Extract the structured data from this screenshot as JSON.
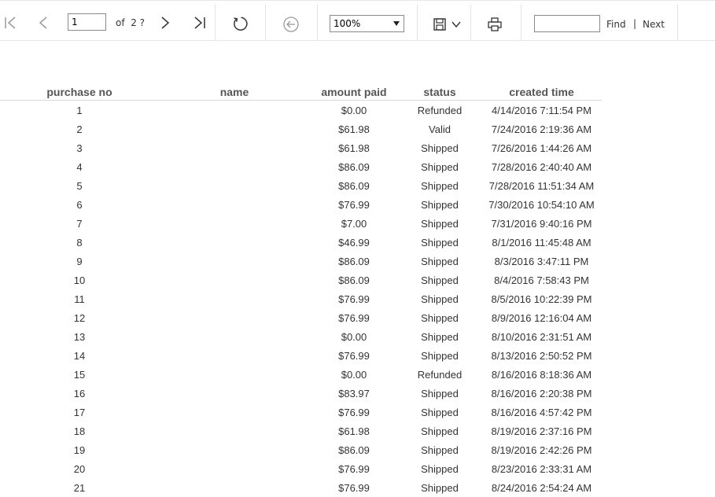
{
  "toolbar": {
    "page_current": "1",
    "page_of_label": "of  2 ?",
    "zoom_value": "100%",
    "find_value": "",
    "find_label": "Find",
    "separator": "|",
    "next_label": "Next",
    "icons": {
      "first_page": "first-page-icon",
      "previous_page": "previous-page-icon",
      "next_page": "next-page-icon",
      "last_page": "last-page-icon",
      "refresh": "refresh-icon",
      "back": "back-icon",
      "save": "save-icon",
      "print": "print-icon"
    }
  },
  "report": {
    "columns": [
      "purchase no",
      "name",
      "amount paid",
      "status",
      "created time"
    ],
    "rows": [
      [
        "1",
        "",
        "$0.00",
        "Refunded",
        "4/14/2016 7:11:54 PM"
      ],
      [
        "2",
        "",
        "$61.98",
        "Valid",
        "7/24/2016 2:19:36 AM"
      ],
      [
        "3",
        "",
        "$61.98",
        "Shipped",
        "7/26/2016 1:44:26 AM"
      ],
      [
        "4",
        "",
        "$86.09",
        "Shipped",
        "7/28/2016 2:40:40 AM"
      ],
      [
        "5",
        "",
        "$86.09",
        "Shipped",
        "7/28/2016 11:51:34 AM"
      ],
      [
        "6",
        "",
        "$76.99",
        "Shipped",
        "7/30/2016 10:54:10 AM"
      ],
      [
        "7",
        "",
        "$7.00",
        "Shipped",
        "7/31/2016 9:40:16 PM"
      ],
      [
        "8",
        "",
        "$46.99",
        "Shipped",
        "8/1/2016 11:45:48 AM"
      ],
      [
        "9",
        "",
        "$86.09",
        "Shipped",
        "8/3/2016 3:47:11 PM"
      ],
      [
        "10",
        "",
        "$86.09",
        "Shipped",
        "8/4/2016 7:58:43 PM"
      ],
      [
        "11",
        "",
        "$76.99",
        "Shipped",
        "8/5/2016 10:22:39 PM"
      ],
      [
        "12",
        "",
        "$76.99",
        "Shipped",
        "8/9/2016 12:16:04 AM"
      ],
      [
        "13",
        "",
        "$0.00",
        "Shipped",
        "8/10/2016 2:31:51 AM"
      ],
      [
        "14",
        "",
        "$76.99",
        "Shipped",
        "8/13/2016 2:50:52 PM"
      ],
      [
        "15",
        "",
        "$0.00",
        "Refunded",
        "8/16/2016 8:18:36 AM"
      ],
      [
        "16",
        "",
        "$83.97",
        "Shipped",
        "8/16/2016 2:20:38 PM"
      ],
      [
        "17",
        "",
        "$76.99",
        "Shipped",
        "8/16/2016 4:57:42 PM"
      ],
      [
        "18",
        "",
        "$61.98",
        "Shipped",
        "8/19/2016 2:37:16 PM"
      ],
      [
        "19",
        "",
        "$86.09",
        "Shipped",
        "8/19/2016 2:42:26 PM"
      ],
      [
        "20",
        "",
        "$76.99",
        "Shipped",
        "8/23/2016 2:33:31 AM"
      ],
      [
        "21",
        "",
        "$76.99",
        "Shipped",
        "8/24/2016 2:54:24 AM"
      ]
    ]
  }
}
